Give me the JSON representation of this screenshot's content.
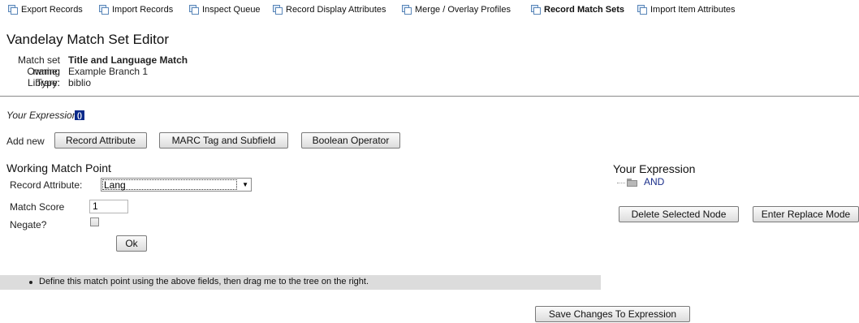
{
  "nav": {
    "items": [
      {
        "label": "Export Records",
        "active": false
      },
      {
        "label": "Import Records",
        "active": false
      },
      {
        "label": "Inspect Queue",
        "active": false
      },
      {
        "label": "Record Display Attributes",
        "active": false
      },
      {
        "label": "Merge / Overlay Profiles",
        "active": false
      },
      {
        "label": "Record Match Sets",
        "active": true
      },
      {
        "label": "Import Item Attributes",
        "active": false
      }
    ]
  },
  "page": {
    "title": "Vandelay Match Set Editor"
  },
  "match_set": {
    "name_label": "Match set name:",
    "name_value": "Title and Language Match",
    "owning_label": "Owning Library:",
    "owning_value": "Example Branch 1",
    "type_label": "Type:",
    "type_value": "biblio"
  },
  "expression": {
    "label": "Your Expression:",
    "icon_text": "()"
  },
  "add_new": {
    "label": "Add new",
    "record_attribute": "Record Attribute",
    "marc_tag": "MARC Tag and Subfield",
    "boolean_operator": "Boolean Operator"
  },
  "working": {
    "heading": "Working Match Point",
    "record_attribute_label": "Record Attribute:",
    "record_attribute_value": "Lang",
    "match_score_label": "Match Score",
    "match_score_value": "1",
    "negate_label": "Negate?",
    "negate_checked": false,
    "ok_button": "Ok",
    "hint": "Define this match point using the above fields, then drag me to the tree on the right."
  },
  "tree": {
    "heading": "Your Expression",
    "node_label": "AND",
    "delete_button": "Delete Selected Node",
    "replace_button": "Enter Replace Mode"
  },
  "save_button": "Save Changes To Expression",
  "colors": {
    "expression_icon_bg": "#0a2a8a",
    "tree_label": "#1a2e8a",
    "hint_bar": "#dcdcdc"
  }
}
